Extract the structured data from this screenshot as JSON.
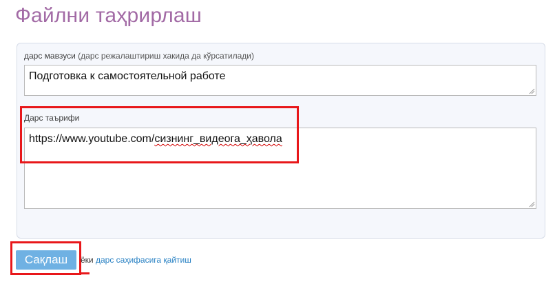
{
  "page": {
    "title": "Файлни таҳрирлаш"
  },
  "form": {
    "topic": {
      "label": "дарс мавзуси",
      "hint": "(дарс режалаштириш хакида да кўрсатилади)",
      "value": "Подготовка к самостоятельной работе"
    },
    "description": {
      "label": "Дарс таърифи",
      "value_prefix": "https://www.youtube.com/",
      "value_misspelled": "сизнинг_видеога_ҳавола"
    }
  },
  "footer": {
    "save_label": "Сақлаш",
    "or_text": "ёки",
    "back_link": "дарс саҳифасига қайтиш"
  },
  "colors": {
    "title": "#a26aa5",
    "panel_bg": "#f5f7fc",
    "button_bg": "#6fb1e3",
    "link": "#2a82c4",
    "highlight": "#e8171a"
  }
}
